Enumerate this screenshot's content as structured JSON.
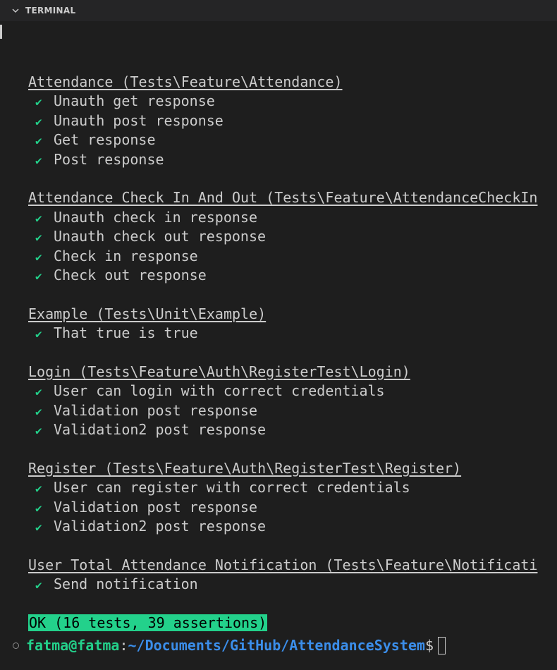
{
  "panel": {
    "title": "TERMINAL",
    "chevron_icon": "chevron-down-icon"
  },
  "suites": [
    {
      "title": "Attendance (Tests\\Feature\\Attendance)",
      "tests": [
        "Unauth get response",
        "Unauth post response",
        "Get response",
        "Post response"
      ]
    },
    {
      "title": "Attendance Check In And Out (Tests\\Feature\\AttendanceCheckIn",
      "tests": [
        "Unauth check in response",
        "Unauth check out response",
        "Check in response",
        "Check out response"
      ]
    },
    {
      "title": "Example (Tests\\Unit\\Example)",
      "tests": [
        "That true is true"
      ]
    },
    {
      "title": "Login (Tests\\Feature\\Auth\\RegisterTest\\Login)",
      "tests": [
        "User can login with correct credentials",
        "Validation post response",
        "Validation2 post response"
      ]
    },
    {
      "title": "Register (Tests\\Feature\\Auth\\RegisterTest\\Register)",
      "tests": [
        "User can register with correct credentials",
        "Validation post response",
        "Validation2 post response"
      ]
    },
    {
      "title": "User Total Attendance Notification (Tests\\Feature\\Notificati",
      "tests": [
        "Send notification"
      ]
    }
  ],
  "check_mark": "✔",
  "summary": "OK (16 tests, 39 assertions)",
  "prompt": {
    "user_host": "fatma@fatma",
    "separator": ":",
    "path": "~/Documents/GitHub/AttendanceSystem",
    "symbol": "$"
  },
  "colors": {
    "background": "#1e1e1e",
    "pass": "#23d18b",
    "path": "#3b8eea",
    "text": "#cccccc"
  }
}
